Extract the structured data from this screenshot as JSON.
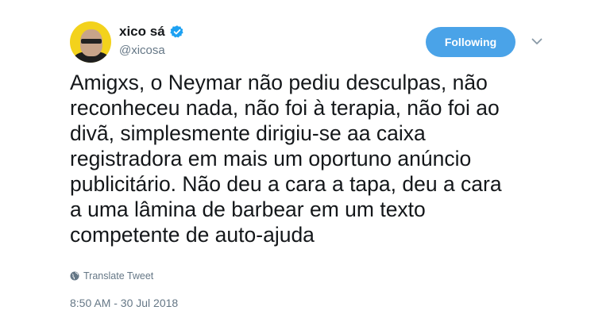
{
  "author": {
    "display_name": "xico sá",
    "handle": "@xicosa",
    "verified": true,
    "avatar_icon": "user-avatar"
  },
  "actions": {
    "follow_label": "Following",
    "more_icon": "chevron-down-icon"
  },
  "tweet": {
    "text": "Amigxs, o Neymar não pediu desculpas, não\nreconheceu nada, não foi à terapia, não foi ao\ndivã, simplesmente dirigiu-se aa caixa\nregistradora em mais um oportuno anúncio\npublicitário. Não deu a cara a tapa, deu a cara\na uma lâmina de barbear em um  texto\ncompetente de auto-ajuda",
    "translate_label": "Translate Tweet",
    "timestamp": "8:50 AM - 30 Jul 2018"
  },
  "colors": {
    "accent": "#4aa3e8",
    "verified": "#1da1f2",
    "secondary_text": "#657786",
    "primary_text": "#14171a"
  }
}
